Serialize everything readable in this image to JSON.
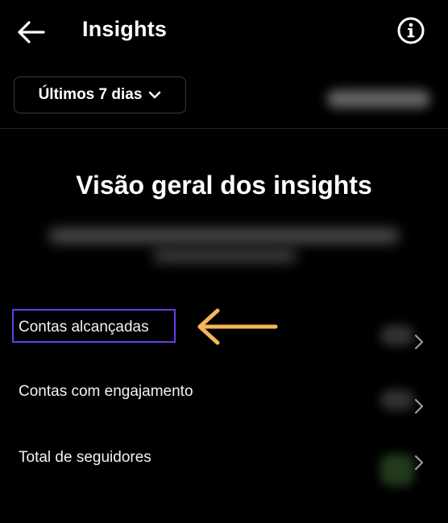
{
  "header": {
    "title": "Insights",
    "back_icon": "arrow-left-icon",
    "info_icon": "info-icon"
  },
  "date_range": {
    "label": "Últimos 7 dias",
    "icon": "chevron-down-icon"
  },
  "overview": {
    "title": "Visão geral dos insights"
  },
  "metrics": [
    {
      "label": "Contas alcançadas",
      "icon": "chevron-right-icon"
    },
    {
      "label": "Contas com engajamento",
      "icon": "chevron-right-icon"
    },
    {
      "label": "Total de seguidores",
      "icon": "chevron-right-icon"
    }
  ],
  "annotation": {
    "highlight_color": "#6a3ce8",
    "arrow_color": "#f5b65b",
    "arrow_icon": "arrow-left-icon"
  }
}
